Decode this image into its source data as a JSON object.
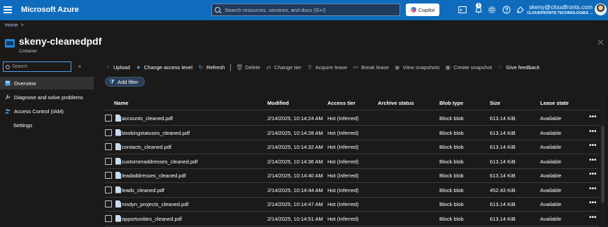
{
  "topbar": {
    "brand": "Microsoft Azure",
    "search_placeholder": "Search resources, services, and docs (G+/)",
    "copilot_label": "Copilot",
    "notification_count": "1",
    "account_email": "skeny@cloudfronts.com",
    "account_org": "CLOUDFRONTS TECHNOLOGIES ..."
  },
  "breadcrumb": {
    "home": "Home",
    "separator": ">"
  },
  "page": {
    "title": "skeny-cleanedpdf",
    "subtitle": "Container"
  },
  "sidebar": {
    "search_placeholder": "Search",
    "collapse_glyph": "«",
    "items": [
      {
        "label": "Overview",
        "active": true
      },
      {
        "label": "Diagnose and solve problems"
      },
      {
        "label": "Access Control (IAM)"
      },
      {
        "label": "Settings"
      }
    ]
  },
  "toolbar": {
    "upload": "Upload",
    "change_access_level": "Change access level",
    "refresh": "Refresh",
    "delete": "Delete",
    "change_tier": "Change tier",
    "acquire_lease": "Acquire lease",
    "break_lease": "Break lease",
    "view_snapshots": "View snapshots",
    "create_snapshot": "Create snapshot",
    "give_feedback": "Give feedback"
  },
  "filter": {
    "add_filter": "Add filter"
  },
  "table": {
    "headers": {
      "name": "Name",
      "modified": "Modified",
      "access_tier": "Access tier",
      "archive_status": "Archive status",
      "blob_type": "Blob type",
      "size": "Size",
      "lease_state": "Lease state"
    },
    "rows": [
      {
        "name": "accounts_cleaned.pdf",
        "modified": "2/14/2025, 10:14:24 AM",
        "access_tier": "Hot (Inferred)",
        "archive_status": "",
        "blob_type": "Block blob",
        "size": "613.14 KiB",
        "lease_state": "Available"
      },
      {
        "name": "bookingstatuses_cleaned.pdf",
        "modified": "2/14/2025, 10:14:28 AM",
        "access_tier": "Hot (Inferred)",
        "archive_status": "",
        "blob_type": "Block blob",
        "size": "613.14 KiB",
        "lease_state": "Available"
      },
      {
        "name": "contacts_cleaned.pdf",
        "modified": "2/14/2025, 10:14:32 AM",
        "access_tier": "Hot (Inferred)",
        "archive_status": "",
        "blob_type": "Block blob",
        "size": "613.14 KiB",
        "lease_state": "Available"
      },
      {
        "name": "customeraddresses_cleaned.pdf",
        "modified": "2/14/2025, 10:14:36 AM",
        "access_tier": "Hot (Inferred)",
        "archive_status": "",
        "blob_type": "Block blob",
        "size": "613.14 KiB",
        "lease_state": "Available"
      },
      {
        "name": "leadaddresses_cleaned.pdf",
        "modified": "2/14/2025, 10:14:40 AM",
        "access_tier": "Hot (Inferred)",
        "archive_status": "",
        "blob_type": "Block blob",
        "size": "613.14 KiB",
        "lease_state": "Available"
      },
      {
        "name": "leads_cleaned.pdf",
        "modified": "2/14/2025, 10:14:44 AM",
        "access_tier": "Hot (Inferred)",
        "archive_status": "",
        "blob_type": "Block blob",
        "size": "452.43 KiB",
        "lease_state": "Available"
      },
      {
        "name": "msdyn_projects_cleaned.pdf",
        "modified": "2/14/2025, 10:14:47 AM",
        "access_tier": "Hot (Inferred)",
        "archive_status": "",
        "blob_type": "Block blob",
        "size": "613.14 KiB",
        "lease_state": "Available"
      },
      {
        "name": "opportunities_cleaned.pdf",
        "modified": "2/14/2025, 10:14:51 AM",
        "access_tier": "Hot (Inferred)",
        "archive_status": "",
        "blob_type": "Block blob",
        "size": "613.14 KiB",
        "lease_state": "Available"
      }
    ],
    "more_glyph": "•••"
  },
  "colors": {
    "topbar": "#0f6cbd",
    "background": "#1b1a19",
    "accent": "#4ea1ef"
  },
  "icons": [
    "hamburger-icon",
    "search-icon",
    "copilot-icon",
    "cloud-shell-icon",
    "bell-icon",
    "gear-icon",
    "help-icon",
    "feedback-icon",
    "container-icon",
    "file-icon",
    "ellipsis-icon"
  ]
}
